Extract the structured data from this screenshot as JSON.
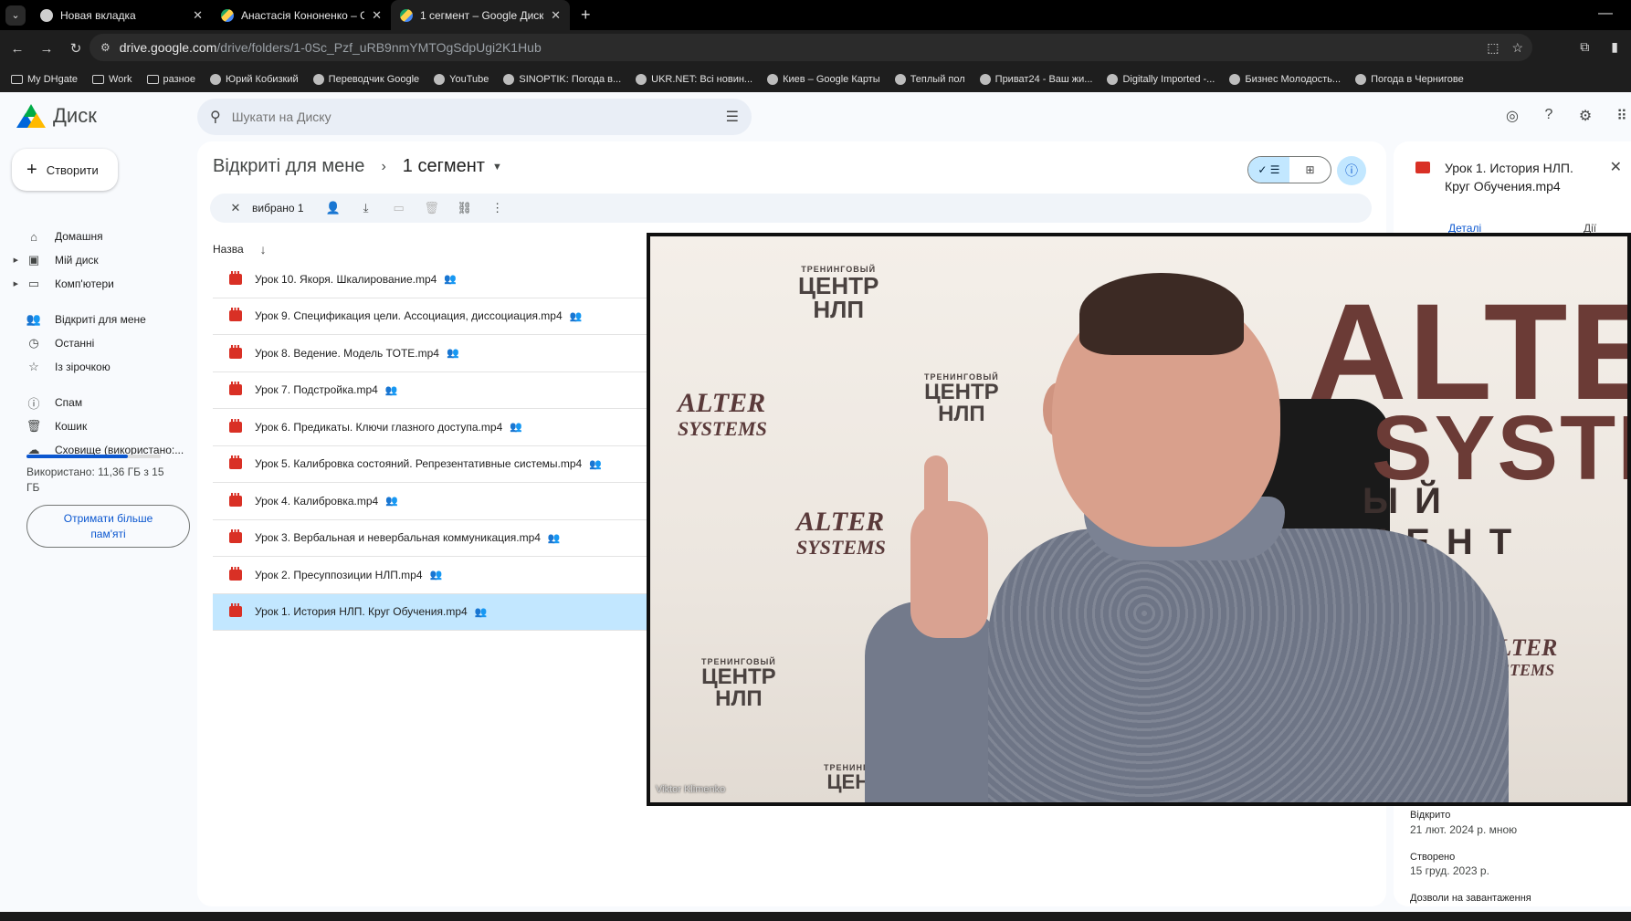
{
  "browser": {
    "tabs": [
      {
        "title": "Новая вкладка",
        "active": false
      },
      {
        "title": "Анастасія Кононенко – Google",
        "active": false
      },
      {
        "title": "1 сегмент – Google Диск",
        "active": true
      }
    ],
    "url_host": "drive.google.com",
    "url_path": "/drive/folders/1-0Sc_Pzf_uRB9nmYMTOgSdpUgi2K1Hub",
    "bookmarks": [
      {
        "label": "My DHgate",
        "icon": "folder-icon"
      },
      {
        "label": "Work",
        "icon": "folder-icon"
      },
      {
        "label": "разное",
        "icon": "folder-icon"
      },
      {
        "label": "Юрий Кобизкий",
        "icon": "globe-icon"
      },
      {
        "label": "Переводчик Google",
        "icon": "globe-icon"
      },
      {
        "label": "YouTube",
        "icon": "globe-icon"
      },
      {
        "label": "SINOPTIK: Погода в...",
        "icon": "globe-icon"
      },
      {
        "label": "UKR.NET: Всі новин...",
        "icon": "globe-icon"
      },
      {
        "label": "Киев – Google Карты",
        "icon": "globe-icon"
      },
      {
        "label": "Теплый пол",
        "icon": "globe-icon"
      },
      {
        "label": "Приват24 - Ваш жи...",
        "icon": "globe-icon"
      },
      {
        "label": "Digitally Imported -...",
        "icon": "globe-icon"
      },
      {
        "label": "Бизнес Молодость...",
        "icon": "globe-icon"
      },
      {
        "label": "Погода в Чернигове",
        "icon": "globe-icon"
      }
    ]
  },
  "drive": {
    "app_name": "Диск",
    "search_placeholder": "Шукати на Диску",
    "create_label": "Створити",
    "sidebar": [
      {
        "label": "Домашня",
        "icon": "home-icon",
        "caret": false
      },
      {
        "label": "Мій диск",
        "icon": "drive-icon",
        "caret": true
      },
      {
        "label": "Комп'ютери",
        "icon": "computer-icon",
        "caret": true
      },
      {
        "label": "Відкриті для мене",
        "icon": "shared-icon",
        "caret": false
      },
      {
        "label": "Останні",
        "icon": "clock-icon",
        "caret": false
      },
      {
        "label": "Із зірочкою",
        "icon": "star-icon",
        "caret": false
      },
      {
        "label": "Спам",
        "icon": "spam-icon",
        "caret": false
      },
      {
        "label": "Кошик",
        "icon": "trash-icon",
        "caret": false
      },
      {
        "label": "Сховище (використано:...",
        "icon": "cloud-icon",
        "caret": false
      }
    ],
    "storage_used_fraction": 0.757,
    "storage_text": "Використано: 11,36 ГБ з 15 ГБ",
    "more_storage_label": "Отримати більше пам'яті",
    "breadcrumb_parent": "Відкриті для мене",
    "breadcrumb_current": "1 сегмент",
    "selection_label": "вибрано 1",
    "column_name": "Назва",
    "files": [
      {
        "name": "Урок 10. Якоря. Шкалирование.mp4",
        "selected": false
      },
      {
        "name": "Урок 9. Спецификация цели. Ассоциация, диссоциация.mp4",
        "selected": false
      },
      {
        "name": "Урок 8. Ведение. Модель TOTE.mp4",
        "selected": false
      },
      {
        "name": "Урок 7. Подстройка.mp4",
        "selected": false
      },
      {
        "name": "Урок 6. Предикаты. Ключи глазного доступа.mp4",
        "selected": false
      },
      {
        "name": "Урок 5. Калибровка состояний. Репрезентативные системы.mp4",
        "selected": false
      },
      {
        "name": "Урок 4. Калибровка.mp4",
        "selected": false
      },
      {
        "name": "Урок 3. Вербальная и невербальная коммуникация.mp4",
        "selected": false
      },
      {
        "name": "Урок 2. Пресуппозиции НЛП.mp4",
        "selected": false
      },
      {
        "name": "Урок 1. История НЛП. Круг Обучения.mp4",
        "selected": true
      }
    ],
    "details": {
      "title": "Урок 1. История НЛП. Круг Обучения.mp4",
      "tab_details": "Деталі",
      "tab_activity": "Дії",
      "opened_label": "Відкрито",
      "opened_value": "21 лют. 2024 р. мною",
      "created_label": "Створено",
      "created_value": "15 груд. 2023 р.",
      "download_perm_label": "Дозволи на завантаження"
    }
  },
  "video": {
    "caption": "Viktor Klimenko",
    "backdrop": {
      "center_line1": "ТРЕНИНГОВЫЙ",
      "center_line2": "ЦЕНТР",
      "center_line3": "НЛП",
      "alter": "ALTER",
      "systems": "SYSTEMS",
      "big_alter": "ALTE",
      "big_systems": "SYSTE",
      "big_center": "ЫЙ ЦЕНТ"
    }
  },
  "colors": {
    "accent": "#0b57d0",
    "selected_row": "#c2e7ff",
    "video_icon": "#d93025"
  }
}
